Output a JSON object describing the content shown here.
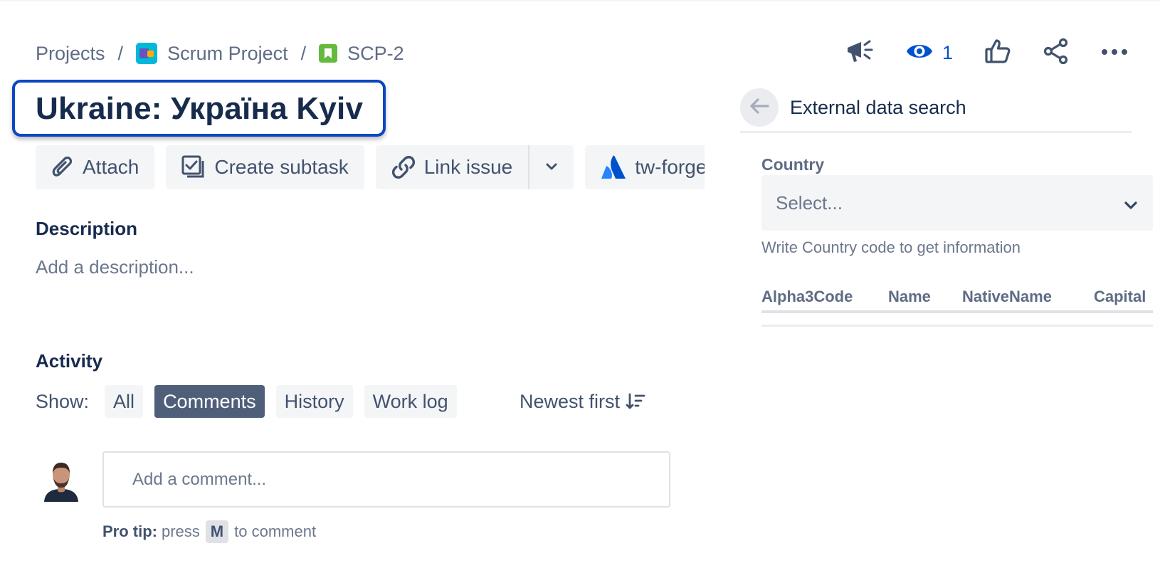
{
  "breadcrumb": {
    "projects": "Projects",
    "separator": "/",
    "project_name": "Scrum Project",
    "issue_key": "SCP-2"
  },
  "actions": {
    "watch_count": "1",
    "icons": [
      "megaphone-icon",
      "eye-icon",
      "thumbs-up-icon",
      "share-icon",
      "more-icon"
    ]
  },
  "issue": {
    "title": "Ukraine: Україна Kyiv"
  },
  "toolbar": {
    "attach": "Attach",
    "create_subtask": "Create subtask",
    "link_issue": "Link issue",
    "app": "tw-forge"
  },
  "description": {
    "heading": "Description",
    "placeholder": "Add a description..."
  },
  "activity": {
    "heading": "Activity",
    "show_label": "Show:",
    "filters": [
      {
        "label": "All",
        "active": false
      },
      {
        "label": "Comments",
        "active": true
      },
      {
        "label": "History",
        "active": false
      },
      {
        "label": "Work log",
        "active": false
      }
    ],
    "sort_label": "Newest first",
    "comment_placeholder": "Add a comment...",
    "pro_tip_label": "Pro tip:",
    "pro_tip_pre": "press",
    "pro_tip_key": "M",
    "pro_tip_post": "to comment"
  },
  "panel": {
    "title": "External data search",
    "field_label": "Country",
    "select_placeholder": "Select...",
    "helper": "Write Country code to get information",
    "columns": [
      "Alpha3Code",
      "Name",
      "NativeName",
      "Capital"
    ]
  },
  "colors": {
    "brand_blue": "#0052cc",
    "highlight_border": "#0a47c2",
    "active_chip": "#505f79",
    "text_primary": "#172b4d",
    "text_secondary": "#42526e",
    "story_green": "#63ba3c"
  }
}
